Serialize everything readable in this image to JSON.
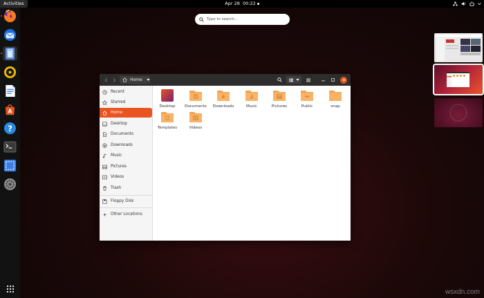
{
  "topbar": {
    "activities_label": "Activities",
    "date": "Apr 28",
    "time": "00:22"
  },
  "search": {
    "placeholder": "Type to search…"
  },
  "dock": {
    "apps": [
      {
        "icon": "firefox-icon"
      },
      {
        "icon": "thunderbird-icon"
      },
      {
        "icon": "files-icon"
      },
      {
        "icon": "rhythmbox-icon"
      },
      {
        "icon": "libreoffice-writer-icon"
      },
      {
        "icon": "ubuntu-software-icon"
      },
      {
        "icon": "help-icon"
      },
      {
        "icon": "terminal-icon"
      },
      {
        "icon": "screenshot-icon"
      },
      {
        "icon": "settings-icon"
      }
    ],
    "show_apps_icon": "show-applications-icon"
  },
  "files_window": {
    "path": "Home",
    "sidebar": [
      {
        "label": "Recent",
        "icon": "clock-icon"
      },
      {
        "label": "Starred",
        "icon": "star-icon"
      },
      {
        "label": "Home",
        "icon": "home-icon",
        "active": true
      },
      {
        "label": "Desktop",
        "icon": "desktop-icon"
      },
      {
        "label": "Documents",
        "icon": "document-icon"
      },
      {
        "label": "Downloads",
        "icon": "download-icon"
      },
      {
        "label": "Music",
        "icon": "music-icon"
      },
      {
        "label": "Pictures",
        "icon": "picture-icon"
      },
      {
        "label": "Videos",
        "icon": "video-icon"
      },
      {
        "label": "Trash",
        "icon": "trash-icon"
      },
      {
        "label": "Floppy Disk",
        "icon": "floppy-icon"
      },
      {
        "label": "Other Locations",
        "icon": "plus-icon"
      }
    ],
    "folders": [
      {
        "label": "Desktop"
      },
      {
        "label": "Documents"
      },
      {
        "label": "Downloads"
      },
      {
        "label": "Music"
      },
      {
        "label": "Pictures"
      },
      {
        "label": "Public"
      },
      {
        "label": "snap"
      },
      {
        "label": "Templates"
      },
      {
        "label": "Videos"
      }
    ]
  },
  "colors": {
    "accent": "#e95420",
    "folder": "#f5a14a",
    "headerbar": "#2d2d2d"
  },
  "watermark": "wsxdn.com"
}
